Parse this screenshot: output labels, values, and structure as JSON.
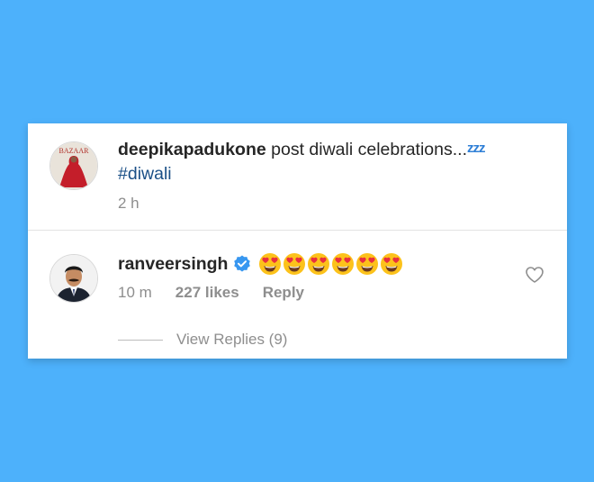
{
  "post": {
    "username": "deepikapadukone",
    "caption_text": "post diwali celebrations...",
    "zzz": "zzz",
    "hashtag": "#diwali",
    "time": "2 h",
    "avatar_label": "BAZAAR"
  },
  "comment": {
    "username": "ranveersingh",
    "emoji_icon": "heart-eyes-emoji-icon",
    "emojis": [
      "😍",
      "😍",
      "😍",
      "😍",
      "😍",
      "😍"
    ],
    "time": "10 m",
    "likes": "227 likes",
    "reply_label": "Reply",
    "view_replies": "View Replies (9)"
  },
  "colors": {
    "background": "#4db1fb",
    "hashtag": "#1a4f86",
    "verified": "#3897f0",
    "muted": "#8e8e8e"
  }
}
